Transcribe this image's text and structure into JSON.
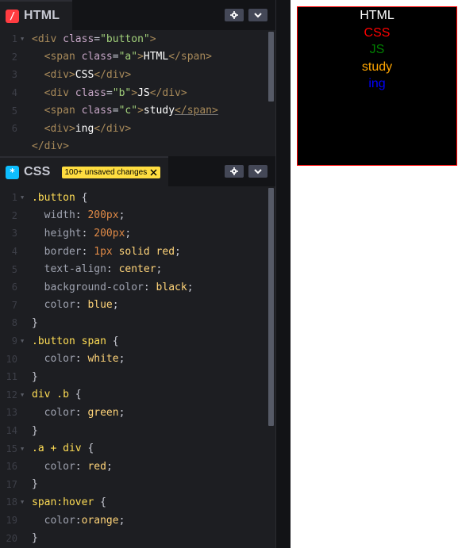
{
  "html_pane": {
    "title": "HTML",
    "badge": "/",
    "badge_color": "#ff3c41",
    "gear_icon": "gear-icon",
    "chevron_icon": "chevron-down-icon",
    "lines": [
      {
        "n": "1",
        "fold": true,
        "tokens": [
          [
            "t-tag",
            "<div "
          ],
          [
            "t-attr",
            "class"
          ],
          [
            "t-punc",
            "="
          ],
          [
            "t-str",
            "\"button\""
          ],
          [
            "t-tag",
            ">"
          ]
        ]
      },
      {
        "n": "2",
        "fold": false,
        "tokens": [
          [
            "t-punc",
            "  "
          ],
          [
            "t-tag",
            "<span "
          ],
          [
            "t-attr",
            "class"
          ],
          [
            "t-punc",
            "="
          ],
          [
            "t-str",
            "\"a\""
          ],
          [
            "t-tag",
            ">"
          ],
          [
            "t-txt",
            "HTML"
          ],
          [
            "t-tag",
            "</span>"
          ]
        ]
      },
      {
        "n": "3",
        "fold": false,
        "tokens": [
          [
            "t-punc",
            "  "
          ],
          [
            "t-tag",
            "<div>"
          ],
          [
            "t-txt",
            "CSS"
          ],
          [
            "t-tag",
            "</div>"
          ]
        ]
      },
      {
        "n": "4",
        "fold": false,
        "tokens": [
          [
            "t-punc",
            "  "
          ],
          [
            "t-tag",
            "<div "
          ],
          [
            "t-attr",
            "class"
          ],
          [
            "t-punc",
            "="
          ],
          [
            "t-str",
            "\"b\""
          ],
          [
            "t-tag",
            ">"
          ],
          [
            "t-txt",
            "JS"
          ],
          [
            "t-tag",
            "</div>"
          ]
        ]
      },
      {
        "n": "5",
        "fold": false,
        "tokens": [
          [
            "t-punc",
            "  "
          ],
          [
            "t-tag",
            "<span "
          ],
          [
            "t-attr",
            "class"
          ],
          [
            "t-punc",
            "="
          ],
          [
            "t-str",
            "\"c\""
          ],
          [
            "t-tag",
            ">"
          ],
          [
            "t-txt",
            "study"
          ],
          [
            "t-tag",
            "</span>"
          ]
        ]
      },
      {
        "n": "6",
        "fold": false,
        "tokens": [
          [
            "t-punc",
            "  "
          ],
          [
            "t-tag",
            "<div>"
          ],
          [
            "t-txt",
            "ing"
          ],
          [
            "t-tag",
            "</div>"
          ]
        ]
      },
      {
        "n": "",
        "fold": false,
        "tokens": [
          [
            "t-tag",
            "</div>"
          ]
        ]
      }
    ]
  },
  "css_pane": {
    "title": "CSS",
    "badge": "*",
    "badge_color": "#0ebeff",
    "unsaved_label": "100+ unsaved changes",
    "unsaved_close_icon": "close-icon",
    "gear_icon": "gear-icon",
    "chevron_icon": "chevron-down-icon",
    "lines": [
      {
        "n": "1",
        "fold": true,
        "tokens": [
          [
            "t-sel",
            ".button "
          ],
          [
            "t-punc",
            "{"
          ]
        ]
      },
      {
        "n": "2",
        "fold": false,
        "tokens": [
          [
            "t-prop",
            "  width"
          ],
          [
            "t-punc",
            ": "
          ],
          [
            "t-num",
            "200px"
          ],
          [
            "t-punc",
            ";"
          ]
        ]
      },
      {
        "n": "3",
        "fold": false,
        "tokens": [
          [
            "t-prop",
            "  height"
          ],
          [
            "t-punc",
            ": "
          ],
          [
            "t-num",
            "200px"
          ],
          [
            "t-punc",
            ";"
          ]
        ]
      },
      {
        "n": "4",
        "fold": false,
        "tokens": [
          [
            "t-prop",
            "  border"
          ],
          [
            "t-punc",
            ": "
          ],
          [
            "t-num",
            "1px "
          ],
          [
            "t-kw",
            "solid red"
          ],
          [
            "t-punc",
            ";"
          ]
        ]
      },
      {
        "n": "5",
        "fold": false,
        "tokens": [
          [
            "t-prop",
            "  text-align"
          ],
          [
            "t-punc",
            ": "
          ],
          [
            "t-kw",
            "center"
          ],
          [
            "t-punc",
            ";"
          ]
        ]
      },
      {
        "n": "6",
        "fold": false,
        "tokens": [
          [
            "t-prop",
            "  background-color"
          ],
          [
            "t-punc",
            ": "
          ],
          [
            "t-kw",
            "black"
          ],
          [
            "t-punc",
            ";"
          ]
        ]
      },
      {
        "n": "7",
        "fold": false,
        "tokens": [
          [
            "t-prop",
            "  color"
          ],
          [
            "t-punc",
            ": "
          ],
          [
            "t-kw",
            "blue"
          ],
          [
            "t-punc",
            ";"
          ]
        ]
      },
      {
        "n": "8",
        "fold": false,
        "tokens": [
          [
            "t-punc",
            "}"
          ]
        ]
      },
      {
        "n": "9",
        "fold": true,
        "tokens": [
          [
            "t-sel",
            ".button span "
          ],
          [
            "t-punc",
            "{"
          ]
        ]
      },
      {
        "n": "10",
        "fold": false,
        "tokens": [
          [
            "t-prop",
            "  color"
          ],
          [
            "t-punc",
            ": "
          ],
          [
            "t-kw",
            "white"
          ],
          [
            "t-punc",
            ";"
          ]
        ]
      },
      {
        "n": "11",
        "fold": false,
        "tokens": [
          [
            "t-punc",
            "}"
          ]
        ]
      },
      {
        "n": "12",
        "fold": true,
        "tokens": [
          [
            "t-sel",
            "div .b "
          ],
          [
            "t-punc",
            "{"
          ]
        ]
      },
      {
        "n": "13",
        "fold": false,
        "tokens": [
          [
            "t-prop",
            "  color"
          ],
          [
            "t-punc",
            ": "
          ],
          [
            "t-kw",
            "green"
          ],
          [
            "t-punc",
            ";"
          ]
        ]
      },
      {
        "n": "14",
        "fold": false,
        "tokens": [
          [
            "t-punc",
            "}"
          ]
        ]
      },
      {
        "n": "15",
        "fold": true,
        "tokens": [
          [
            "t-sel",
            ".a + div "
          ],
          [
            "t-punc",
            "{"
          ]
        ]
      },
      {
        "n": "16",
        "fold": false,
        "tokens": [
          [
            "t-prop",
            "  color"
          ],
          [
            "t-punc",
            ": "
          ],
          [
            "t-kw",
            "red"
          ],
          [
            "t-punc",
            ";"
          ]
        ]
      },
      {
        "n": "17",
        "fold": false,
        "tokens": [
          [
            "t-punc",
            "}"
          ]
        ]
      },
      {
        "n": "18",
        "fold": true,
        "tokens": [
          [
            "t-sel",
            "span:hover "
          ],
          [
            "t-punc",
            "{"
          ]
        ]
      },
      {
        "n": "19",
        "fold": false,
        "tokens": [
          [
            "t-prop",
            "  color"
          ],
          [
            "t-punc",
            ":"
          ],
          [
            "t-kw",
            "orange"
          ],
          [
            "t-punc",
            ";"
          ]
        ]
      },
      {
        "n": "20",
        "fold": false,
        "tokens": [
          [
            "t-punc",
            "}"
          ]
        ]
      }
    ]
  },
  "preview": {
    "items": [
      {
        "text": "HTML",
        "color": "#ffffff"
      },
      {
        "text": "CSS",
        "color": "#ff0000"
      },
      {
        "text": "JS",
        "color": "#008000"
      },
      {
        "text": "study",
        "color": "#ffa500"
      },
      {
        "text": "ing",
        "color": "#0000ff"
      }
    ]
  }
}
